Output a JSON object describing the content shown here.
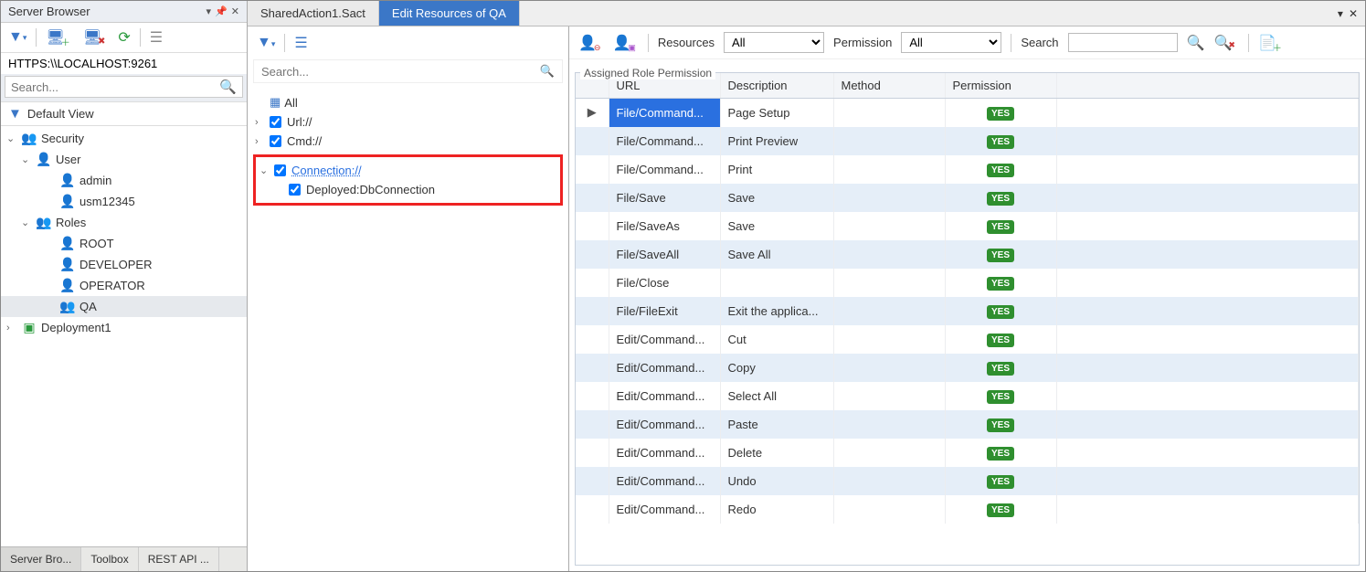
{
  "left": {
    "title": "Server Browser",
    "url": "HTTPS:\\\\LOCALHOST:9261",
    "search_placeholder": "Search...",
    "default_view": "Default View",
    "tree": {
      "security": "Security",
      "user": "User",
      "admin": "admin",
      "usm": "usm12345",
      "roles": "Roles",
      "root": "ROOT",
      "developer": "DEVELOPER",
      "operator": "OPERATOR",
      "qa": "QA",
      "deployment": "Deployment1"
    },
    "bottom_tabs": [
      "Server Bro...",
      "Toolbox",
      "REST API ..."
    ]
  },
  "tabs": {
    "shared": "SharedAction1.Sact",
    "edit": "Edit Resources of QA"
  },
  "mid": {
    "search_placeholder": "Search...",
    "all": "All",
    "url": "Url://",
    "cmd": "Cmd://",
    "connection": "Connection://",
    "deployed": "Deployed:DbConnection"
  },
  "grid": {
    "resources_label": "Resources",
    "resources_value": "All",
    "permission_label": "Permission",
    "permission_value": "All",
    "search_label": "Search",
    "legend": "Assigned Role Permission",
    "headers": {
      "url": "URL",
      "description": "Description",
      "method": "Method",
      "permission": "Permission"
    },
    "rows": [
      {
        "url": "File/Command...",
        "desc": "Page Setup",
        "method": "",
        "perm": "YES",
        "sel": true
      },
      {
        "url": "File/Command...",
        "desc": "Print Preview",
        "method": "",
        "perm": "YES"
      },
      {
        "url": "File/Command...",
        "desc": "Print",
        "method": "",
        "perm": "YES"
      },
      {
        "url": "File/Save",
        "desc": "Save",
        "method": "",
        "perm": "YES"
      },
      {
        "url": "File/SaveAs",
        "desc": "Save",
        "method": "",
        "perm": "YES"
      },
      {
        "url": "File/SaveAll",
        "desc": "Save All",
        "method": "",
        "perm": "YES"
      },
      {
        "url": "File/Close",
        "desc": "",
        "method": "",
        "perm": "YES"
      },
      {
        "url": "File/FileExit",
        "desc": "Exit the applica...",
        "method": "",
        "perm": "YES"
      },
      {
        "url": "Edit/Command...",
        "desc": "Cut",
        "method": "",
        "perm": "YES"
      },
      {
        "url": "Edit/Command...",
        "desc": "Copy",
        "method": "",
        "perm": "YES"
      },
      {
        "url": "Edit/Command...",
        "desc": "Select All",
        "method": "",
        "perm": "YES"
      },
      {
        "url": "Edit/Command...",
        "desc": "Paste",
        "method": "",
        "perm": "YES"
      },
      {
        "url": "Edit/Command...",
        "desc": "Delete",
        "method": "",
        "perm": "YES"
      },
      {
        "url": "Edit/Command...",
        "desc": "Undo",
        "method": "",
        "perm": "YES"
      },
      {
        "url": "Edit/Command...",
        "desc": "Redo",
        "method": "",
        "perm": "YES"
      }
    ]
  }
}
